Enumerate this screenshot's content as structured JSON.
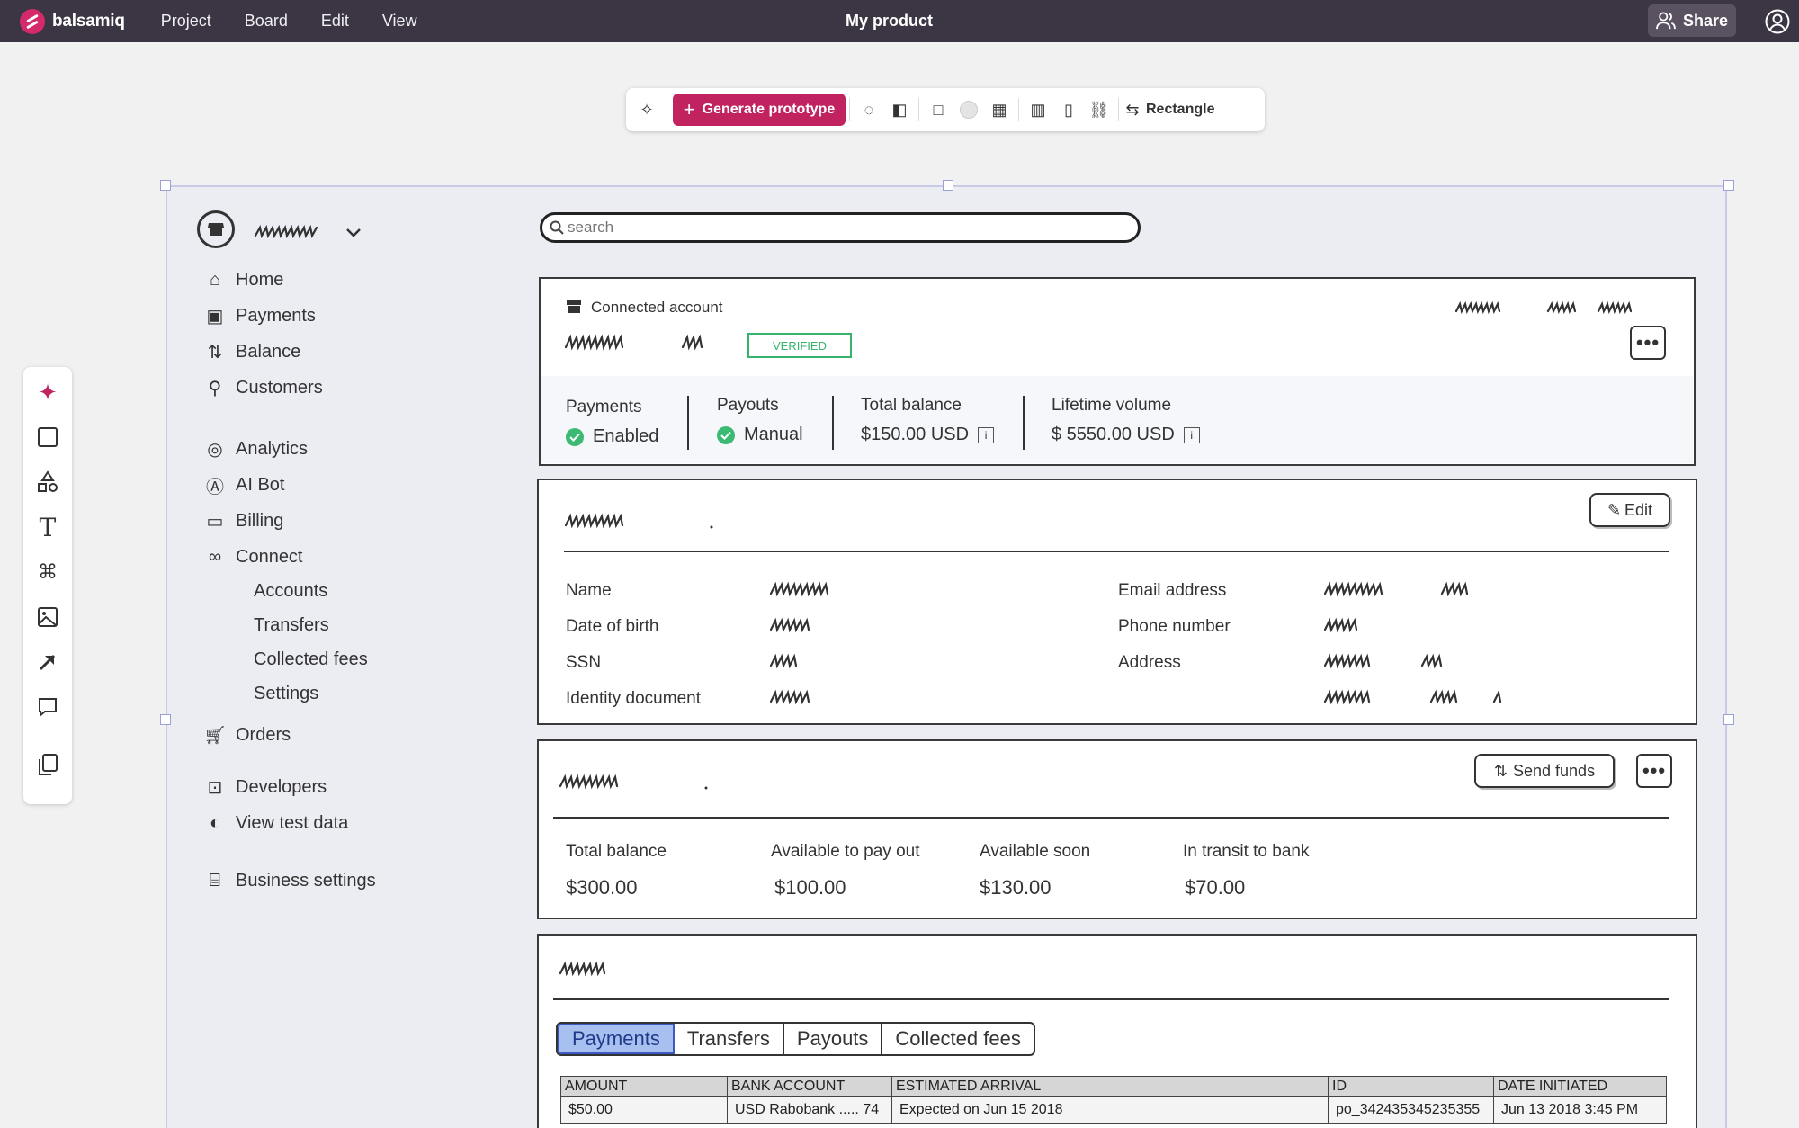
{
  "app": {
    "name": "balsamiq",
    "menu": [
      "Project",
      "Board",
      "Edit",
      "View"
    ],
    "doc_title": "My product",
    "share_label": "Share"
  },
  "toolbar": {
    "generate_label": "Generate prototype",
    "shape_label": "Rectangle"
  },
  "mockup": {
    "search_placeholder": "search",
    "nav": {
      "home": "Home",
      "payments": "Payments",
      "balance": "Balance",
      "customers": "Customers",
      "analytics": "Analytics",
      "ai_bot": "AI Bot",
      "billing": "Billing",
      "connect": "Connect",
      "accounts": "Accounts",
      "transfers": "Transfers",
      "collected_fees": "Collected fees",
      "settings": "Settings",
      "orders": "Orders",
      "developers": "Developers",
      "view_test_data": "View test data",
      "business_settings": "Business settings"
    },
    "account_card": {
      "header": "Connected account",
      "badge": "VERIFIED",
      "stats": [
        {
          "label": "Payments",
          "value": "Enabled"
        },
        {
          "label": "Payouts",
          "value": "Manual"
        },
        {
          "label": "Total balance",
          "value": "$150.00 USD"
        },
        {
          "label": "Lifetime volume",
          "value": "$ 5550.00 USD"
        }
      ],
      "info_glyph": "i"
    },
    "details_card": {
      "edit_label": "Edit",
      "fields_left": [
        "Name",
        "Date of birth",
        "SSN",
        "Identity document"
      ],
      "fields_right": [
        "Email address",
        "Phone number",
        "Address"
      ]
    },
    "balance_card": {
      "send_label": "Send funds",
      "columns": [
        {
          "label": "Total balance",
          "value": "$300.00"
        },
        {
          "label": "Available to pay out",
          "value": "$100.00"
        },
        {
          "label": "Available soon",
          "value": "$130.00"
        },
        {
          "label": "In transit to bank",
          "value": "$70.00"
        }
      ]
    },
    "activity_card": {
      "tabs": [
        "Payments",
        "Transfers",
        "Payouts",
        "Collected fees"
      ],
      "table_headers": [
        "AMOUNT",
        "BANK ACCOUNT",
        "ESTIMATED ARRIVAL",
        "ID",
        "DATE INITIATED"
      ],
      "rows": [
        [
          "$50.00",
          "USD Rabobank ..... 74",
          "Expected on Jun 15 2018",
          "po_342435345235355",
          "Jun 13 2018 3:45 PM"
        ]
      ]
    }
  },
  "colors": {
    "topbar": "#3c3543",
    "brand": "#c0235f",
    "verified": "#38b36c",
    "active_tab": "#a8c0ef"
  }
}
